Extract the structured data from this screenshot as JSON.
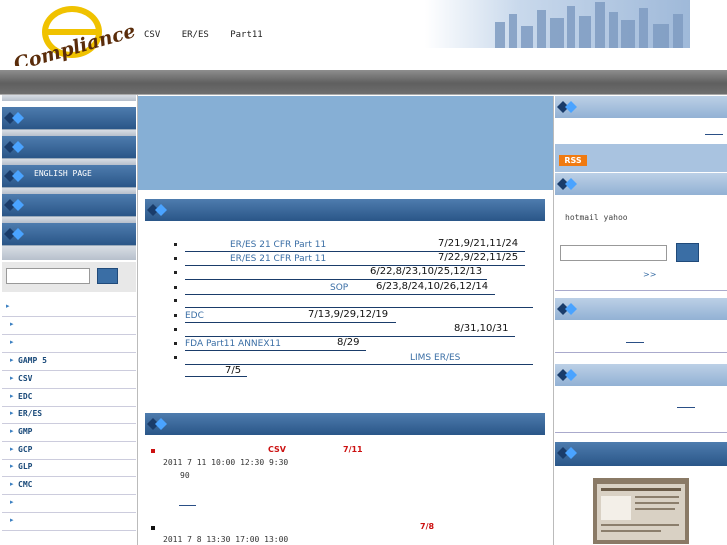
{
  "header": {
    "logo_text": "Compliance",
    "logo_letter": "e",
    "nav": [
      "CSV",
      "ER/ES",
      "Part11"
    ]
  },
  "left_sidebar": {
    "bars": [
      {
        "label": ""
      },
      {
        "label": ""
      },
      {
        "label": "ENGLISH PAGE"
      },
      {
        "label": ""
      },
      {
        "label": ""
      }
    ],
    "search": {
      "placeholder": ""
    },
    "items": [
      "",
      "",
      "",
      "GAMP 5",
      "CSV",
      "EDC",
      "ER/ES",
      "GMP",
      "GCP",
      "GLP",
      "CMC",
      "",
      ""
    ]
  },
  "news": {
    "items": [
      {
        "text": "ER/ES   21 CFR Part 11",
        "date": "7/21,9/21,11/24"
      },
      {
        "text": "ER/ES   21 CFR Part 11",
        "date": "7/22,9/22,11/25"
      },
      {
        "text": "",
        "date": "6/22,8/23,10/25,12/13"
      },
      {
        "text": "SOP",
        "date": "6/23,8/24,10/26,12/14"
      },
      {
        "text": "",
        "date": ""
      },
      {
        "text": "EDC",
        "date": "7/13,9/29,12/19"
      },
      {
        "text": "",
        "date": "8/31,10/31"
      },
      {
        "text": "FDA Part11        ANNEX11",
        "date": "8/29"
      },
      {
        "text": "LIMS           ER/ES",
        "date": "7/5"
      }
    ]
  },
  "events": [
    {
      "title": "CSV",
      "date": "7/11",
      "line1": "2011  7  11        10:00  12:30      9:30",
      "line2": "90"
    },
    {
      "title": "",
      "date": "7/8",
      "line1": "2011  7  8         13:30  17:00      13:00",
      "line2": ""
    }
  ],
  "right_sidebar": {
    "rss": "RSS",
    "login": {
      "text": "hotmail  yahoo",
      "more": ">>"
    }
  },
  "colors": {
    "accent": "#2a5688",
    "banner": "#86afd5",
    "rss": "#f07a10",
    "event_red": "#cc1111"
  }
}
